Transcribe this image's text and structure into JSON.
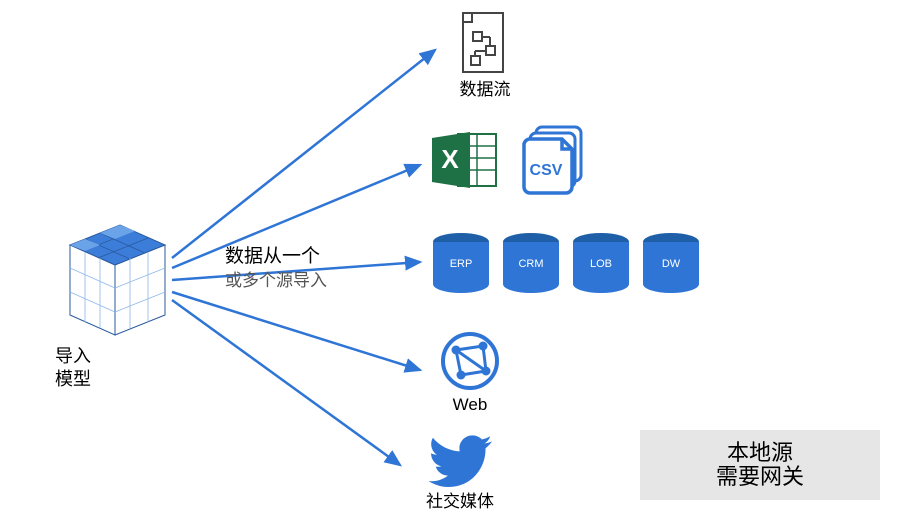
{
  "source": {
    "title_line1": "导入",
    "title_line2": "模型"
  },
  "center": {
    "line1": "数据从一个",
    "line2": "或多个源导入"
  },
  "targets": {
    "dataflow": {
      "label": "数据流"
    },
    "files": {
      "csv_label": "CSV"
    },
    "databases": [
      {
        "label": "ERP"
      },
      {
        "label": "CRM"
      },
      {
        "label": "LOB"
      },
      {
        "label": "DW"
      }
    ],
    "web": {
      "label": "Web"
    },
    "social": {
      "label": "社交媒体"
    }
  },
  "note": {
    "line1": "本地源",
    "line2": "需要网关"
  },
  "colors": {
    "arrow": "#2e75d6",
    "db": "#2e75d6",
    "db_top": "#1f5fa8",
    "excel": "#1e7145",
    "note_bg": "#e6e6e6"
  }
}
